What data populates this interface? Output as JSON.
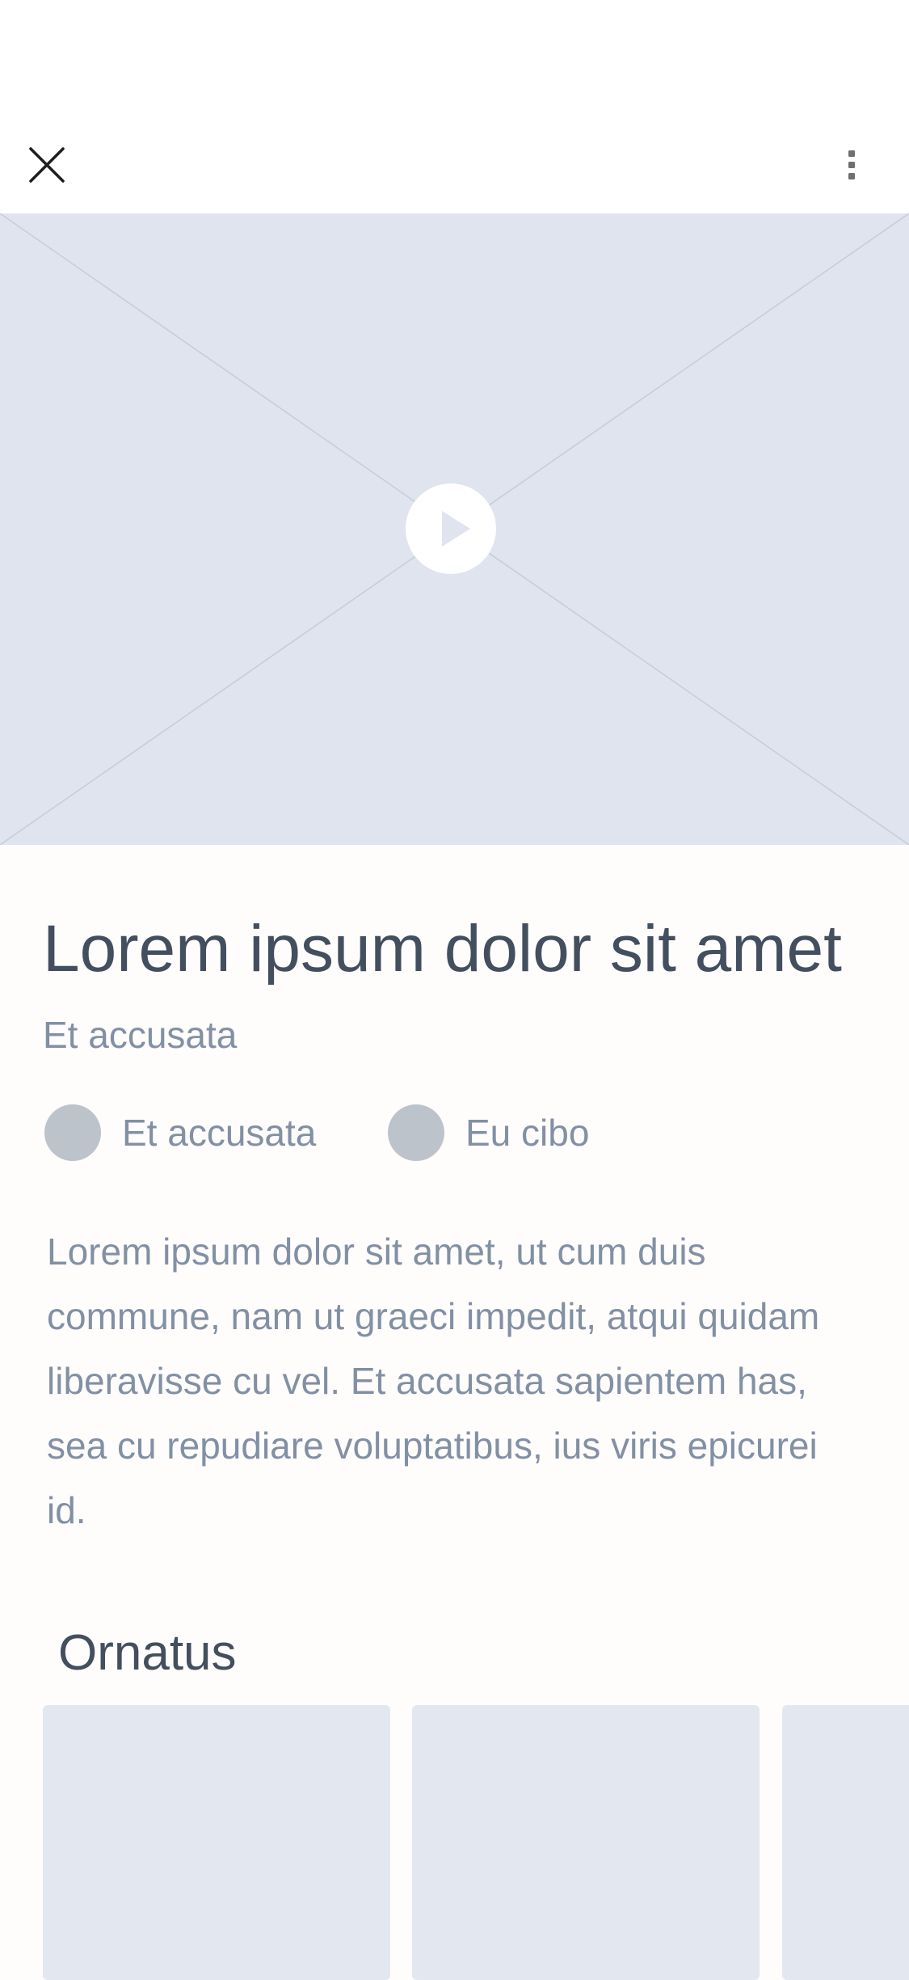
{
  "header": {
    "close_icon": "close-icon",
    "more_icon": "more-vertical-icon"
  },
  "hero": {
    "media": "image-placeholder",
    "play_icon": "play-icon"
  },
  "content": {
    "title": "Lorem ipsum dolor sit amet",
    "subtitle": "Et accusata",
    "meta": [
      {
        "label": "Et accusata"
      },
      {
        "label": "Eu cibo"
      }
    ],
    "body": "Lorem ipsum dolor sit amet, ut cum duis commune, nam ut graeci impedit, atqui quidam liberavisse cu vel. Et accusata sapientem has, sea cu repudiare voluptatibus, ius viris epicurei id."
  },
  "section": {
    "title": "Ornatus",
    "card_count": 3
  },
  "colors": {
    "background": "#FFFCFC",
    "placeholder": "#DFE4EE",
    "card": "#E3E7F0",
    "heading": "#434F5E",
    "text": "#8290A4",
    "avatar": "#BDC3CB"
  }
}
